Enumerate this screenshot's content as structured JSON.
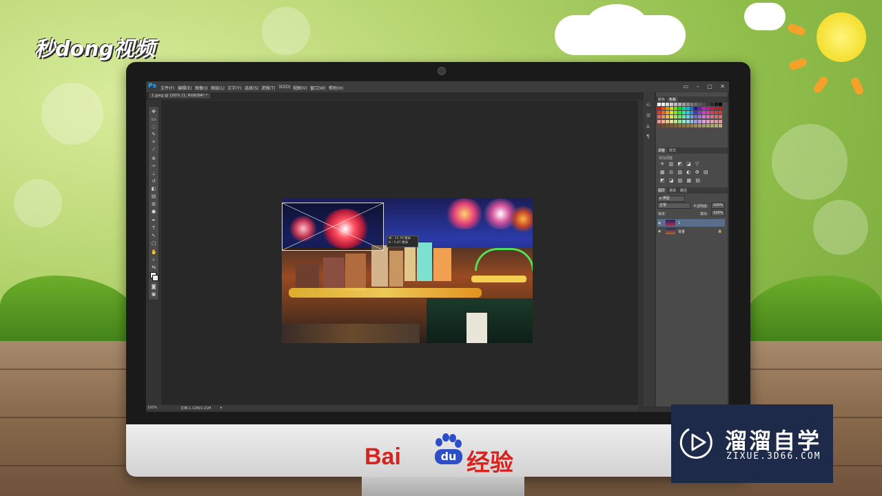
{
  "watermark": {
    "logo": "秒dong视频"
  },
  "photoshop": {
    "app_badge": "Ps",
    "menu": [
      "文件(F)",
      "编辑(E)",
      "图像(I)",
      "图层(L)",
      "文字(Y)",
      "选择(S)",
      "滤镜(T)",
      "3D(D)",
      "视图(V)",
      "窗口(W)",
      "帮助(H)"
    ],
    "window_controls": [
      "▭",
      "–",
      "▢",
      "✕"
    ],
    "document_tab": "1.jpeg @ 100% (1, RGB/8#) *",
    "measure_readout": {
      "w": "W : 11.76 厘米",
      "h": "H : 5.47 厘米"
    },
    "panels": {
      "swatches_tabs": [
        "颜色",
        "色板"
      ],
      "adjust_tabs": [
        "调整",
        "样式"
      ],
      "adjust_label": "添加调整",
      "adjust_rows": [
        "☀ ▥ ◩ ◪ ▽",
        "▦ ⚖ ▧ ◐ ♻ ▤",
        "◩ ◪ ▨ ▩ ▤"
      ],
      "layers_tabs": [
        "图层",
        "通道",
        "路径"
      ],
      "kind_filter": "ρ 类型",
      "blend_mode": "正常",
      "opacity_label": "不透明度:",
      "opacity_value": "100%",
      "lock_label": "锁定:",
      "fill_label": "填充:",
      "fill_value": "100%",
      "layers": [
        {
          "name": "1",
          "locked": false
        },
        {
          "name": "背景",
          "locked": true
        }
      ]
    },
    "status": {
      "zoom": "100%",
      "doc": "文档:1.11M/2.21M"
    }
  },
  "monitor_brand": {
    "left": "Bai",
    "badge": "du",
    "right": "经验"
  },
  "brand_box": {
    "cn": "溜溜自学",
    "en": "ZIXUE.3D66.COM"
  },
  "colors": {
    "ps_blue": "#31a8ff",
    "baidu_red": "#d8221f",
    "baidu_blue": "#2d4ec9",
    "brand_bg": "#1e2a4a"
  }
}
